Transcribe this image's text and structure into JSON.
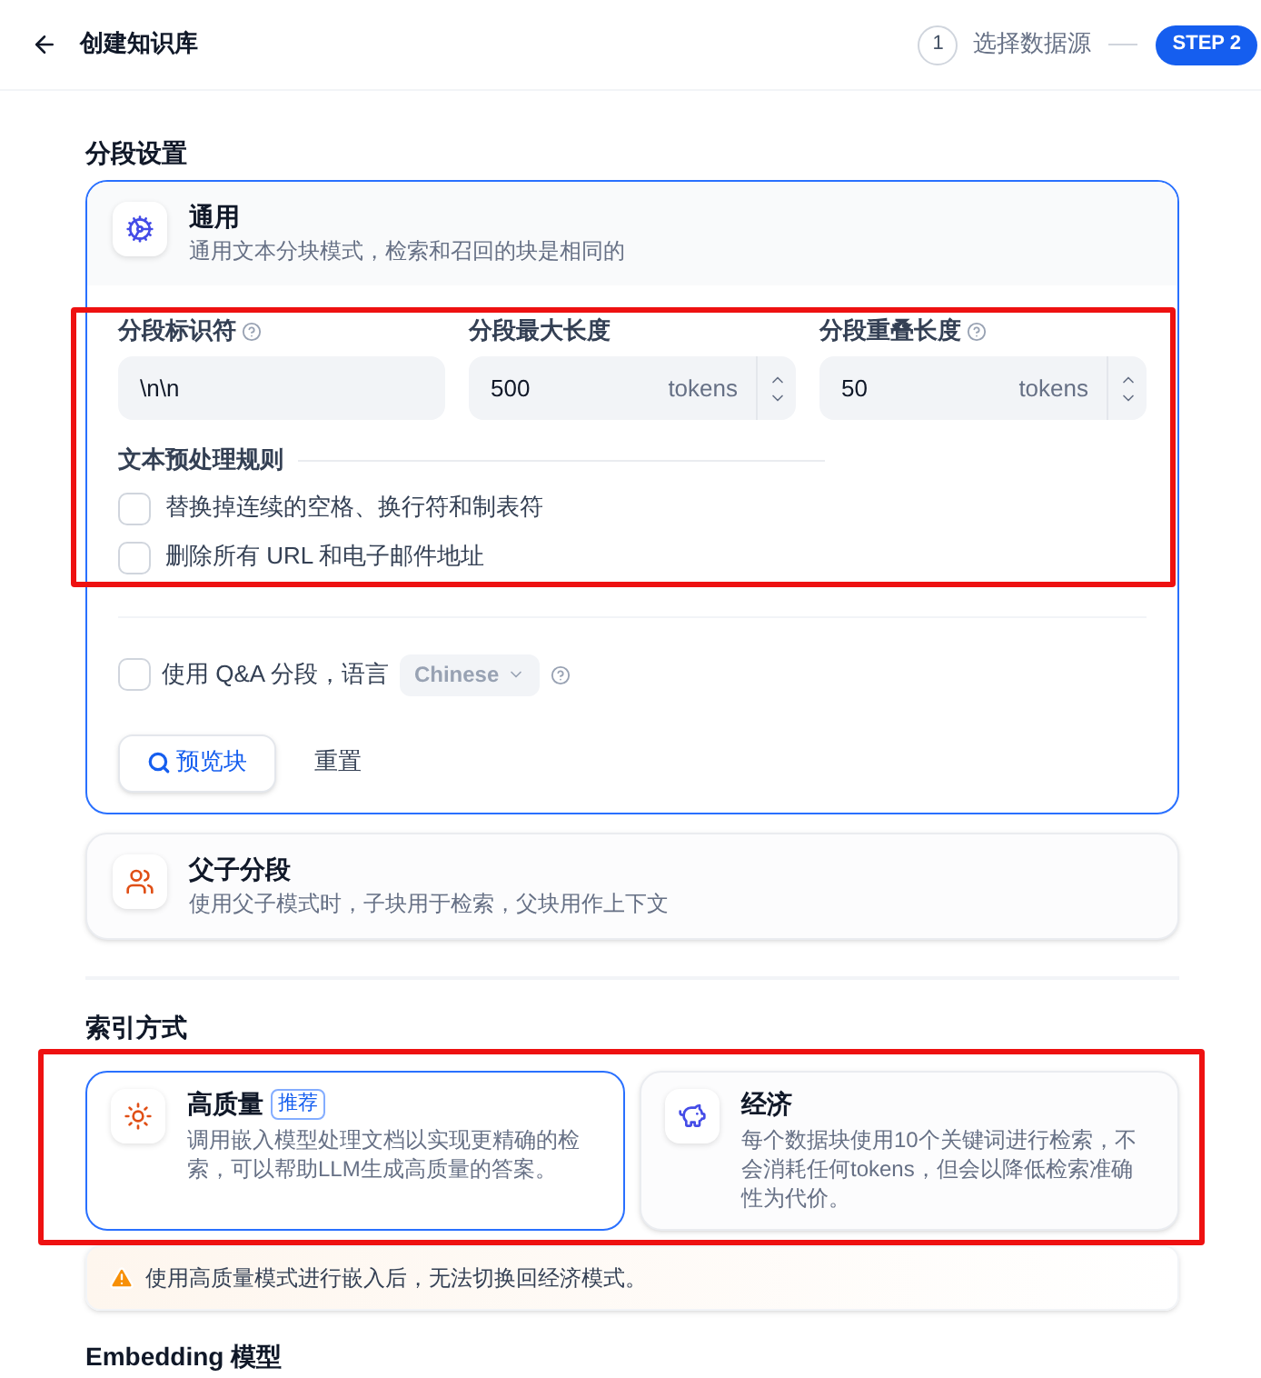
{
  "header": {
    "title": "创建知识库",
    "steps": [
      {
        "number": "1",
        "label": "选择数据源",
        "selected": false
      },
      {
        "label": "STEP 2",
        "selected": true
      }
    ]
  },
  "segment_section": {
    "title": "分段设置",
    "modes": [
      {
        "kind": "general",
        "title": "通用",
        "description": "通用文本分块模式，检索和召回的块是相同的",
        "selected": true,
        "fields": [
          {
            "label": "分段标识符",
            "help": true,
            "value": "\\n\\n"
          },
          {
            "label": "分段最大长度",
            "help": false,
            "value": "500",
            "unit": "tokens"
          },
          {
            "label": "分段重叠长度",
            "help": true,
            "value": "50",
            "unit": "tokens"
          }
        ],
        "rules_title": "文本预处理规则",
        "rules": [
          {
            "label": "替换掉连续的空格、换行符和制表符",
            "checked": false
          },
          {
            "label": "删除所有 URL 和电子邮件地址",
            "checked": false
          }
        ],
        "qa": {
          "label": "使用 Q&A 分段，语言",
          "checked": false,
          "language": "Chinese"
        },
        "preview_button": "预览块",
        "reset_button": "重置"
      },
      {
        "kind": "parent_child",
        "title": "父子分段",
        "description": "使用父子模式时，子块用于检索，父块用作上下文",
        "selected": false
      }
    ]
  },
  "index_section": {
    "title": "索引方式",
    "options": [
      {
        "kind": "high",
        "title": "高质量",
        "badge": "推荐",
        "description": "调用嵌入模型处理文档以实现更精确的检索，可以帮助LLM生成高质量的答案。",
        "selected": true
      },
      {
        "kind": "economy",
        "title": "经济",
        "description": "每个数据块使用10个关键词进行检索，不会消耗任何tokens，但会以降低检索准确性为代价。",
        "selected": false
      }
    ],
    "warning": "使用高质量模式进行嵌入后，无法切换回经济模式。"
  },
  "embedding_section": {
    "title": "Embedding 模型"
  }
}
